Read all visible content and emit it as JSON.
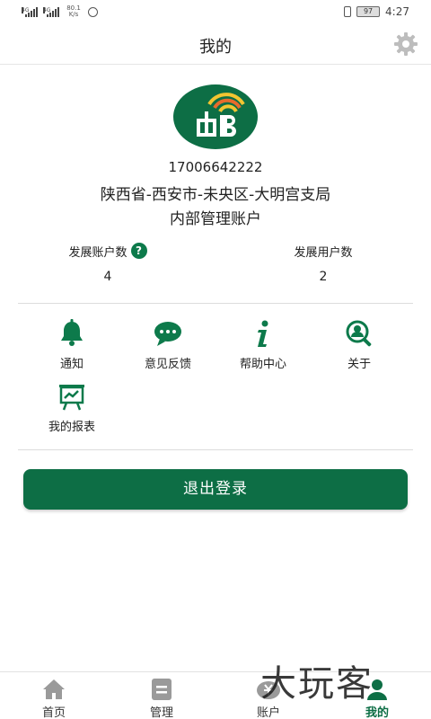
{
  "status_bar": {
    "sim1": "4G",
    "sim2": "4G",
    "speed": "80.1 K/s",
    "battery": "97",
    "time": "4:27"
  },
  "header": {
    "title": "我的"
  },
  "profile": {
    "phone": "17006642222",
    "org": "陕西省-西安市-未央区-大明宫支局",
    "account_type": "内部管理账户"
  },
  "stats": {
    "accounts_label": "发展账户数",
    "accounts_value": "4",
    "users_label": "发展用户数",
    "users_value": "2"
  },
  "menu": {
    "notify": "通知",
    "feedback": "意见反馈",
    "help": "帮助中心",
    "about": "关于",
    "reports": "我的报表"
  },
  "logout_label": "退出登录",
  "bottom_nav": {
    "home": "首页",
    "manage": "管理",
    "account": "账户",
    "mine": "我的"
  },
  "watermark": {
    "text": "大玩客"
  },
  "colors": {
    "brand_green": "#0d6e45",
    "icon_green": "#0d7a4b"
  }
}
